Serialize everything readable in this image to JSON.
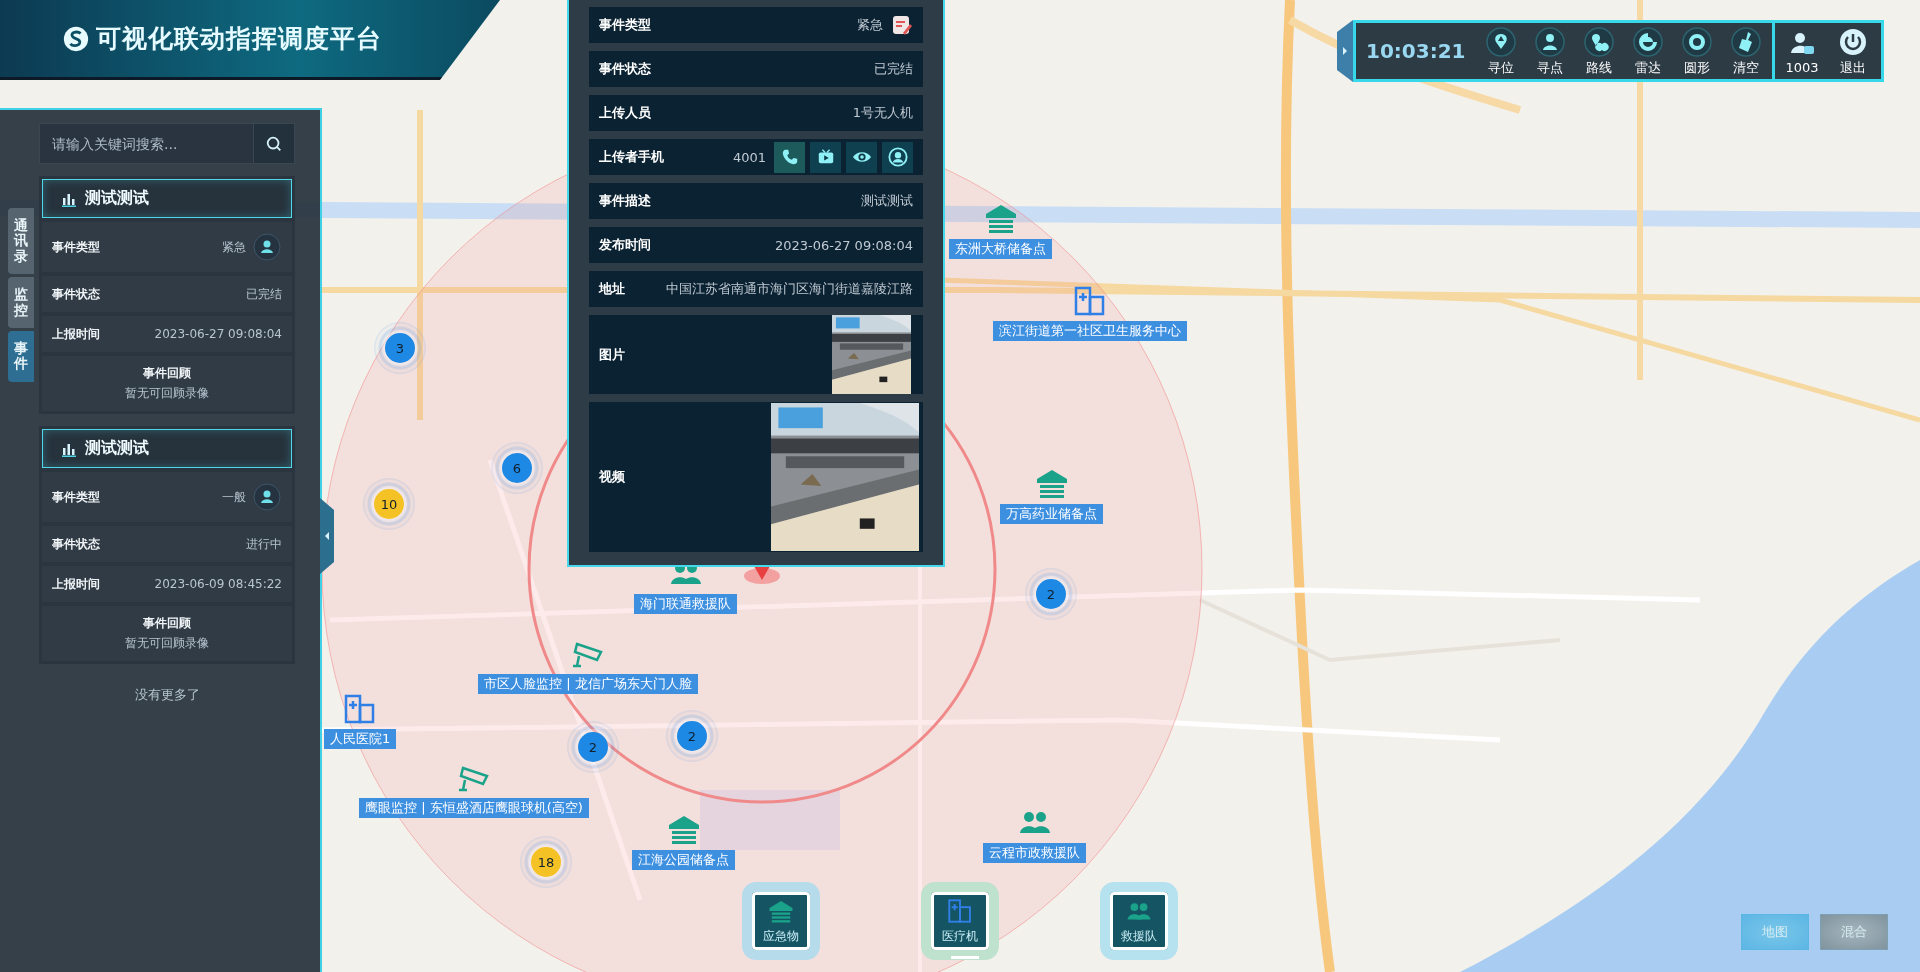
{
  "header": {
    "title": "可视化联动指挥调度平台"
  },
  "side_tabs": [
    {
      "label": "通讯录",
      "selected": false
    },
    {
      "label": "监控",
      "selected": false
    },
    {
      "label": "事件",
      "selected": true
    }
  ],
  "search": {
    "placeholder": "请输入关键词搜索..."
  },
  "events": [
    {
      "title": "测试测试",
      "rows": [
        {
          "label": "事件类型",
          "value": "紧急",
          "kind": "type"
        },
        {
          "label": "事件状态",
          "value": "已完结",
          "kind": "text"
        },
        {
          "label": "上报时间",
          "value": "2023-06-27 09:08:04",
          "kind": "text"
        }
      ],
      "review": {
        "title": "事件回顾",
        "text": "暂无可回顾录像"
      }
    },
    {
      "title": "测试测试",
      "rows": [
        {
          "label": "事件类型",
          "value": "一般",
          "kind": "type"
        },
        {
          "label": "事件状态",
          "value": "进行中",
          "kind": "text"
        },
        {
          "label": "上报时间",
          "value": "2023-06-09 08:45:22",
          "kind": "text"
        }
      ],
      "review": {
        "title": "事件回顾",
        "text": "暂无可回顾录像"
      }
    }
  ],
  "list_end": "没有更多了",
  "popup": {
    "rows": [
      {
        "label": "事件类型",
        "value": "紧急",
        "kind": "type"
      },
      {
        "label": "事件状态",
        "value": "已完结",
        "kind": "text"
      },
      {
        "label": "上传人员",
        "value": "1号无人机",
        "kind": "text"
      },
      {
        "label": "上传者手机",
        "value": "4001",
        "kind": "phone"
      },
      {
        "label": "事件描述",
        "value": "测试测试",
        "kind": "text"
      },
      {
        "label": "发布时间",
        "value": "2023-06-27 09:08:04",
        "kind": "text"
      },
      {
        "label": "地址",
        "value": "中国江苏省南通市海门区海门街道嘉陵江路",
        "kind": "text"
      },
      {
        "label": "图片"
      },
      {
        "label": "视频",
        "kind": "video"
      }
    ]
  },
  "toolbar": {
    "time": "10:03:21",
    "tools": [
      {
        "label": "寻位"
      },
      {
        "label": "寻点"
      },
      {
        "label": "路线"
      },
      {
        "label": "雷达"
      },
      {
        "label": "圆形"
      },
      {
        "label": "清空"
      }
    ],
    "user": "1003",
    "logout": "退出"
  },
  "map": {
    "clusters": [
      {
        "count": "3",
        "color": "#1e88e5"
      },
      {
        "count": "6",
        "color": "#1e88e5"
      },
      {
        "count": "10",
        "color": "#f5c226"
      },
      {
        "count": "2",
        "color": "#1e88e5"
      },
      {
        "count": "2",
        "color": "#1e88e5"
      },
      {
        "count": "2",
        "color": "#1e88e5"
      },
      {
        "count": "18",
        "color": "#f5c226"
      }
    ],
    "tags": [
      "东洲大桥储备点",
      "滨江街道第一社区卫生服务中心",
      "万高药业储备点",
      "海门联通救援队",
      "市区人脸监控 | 龙信广场东大门人脸",
      "人民医院1",
      "鹰眼监控 | 东恒盛酒店鹰眼球机(高空)",
      "江海公园储备点",
      "云程市政救援队"
    ]
  },
  "layers": [
    {
      "label": "应急物",
      "color": "#b6dcec",
      "selected": false
    },
    {
      "label": "医疗机",
      "color": "#bfe2cf",
      "selected": true
    },
    {
      "label": "救援队",
      "color": "#b6e2ef",
      "selected": false
    }
  ],
  "map_modes": [
    {
      "label": "地图",
      "selected": true
    },
    {
      "label": "混合",
      "selected": false
    }
  ]
}
